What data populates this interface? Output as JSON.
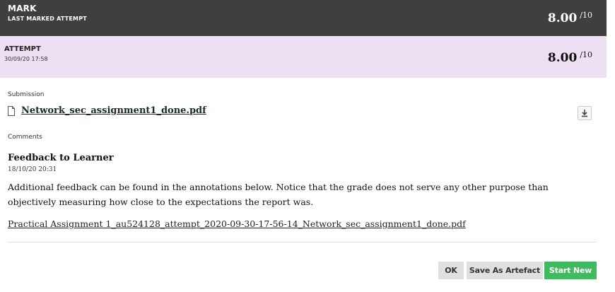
{
  "mark": {
    "title": "MARK",
    "subtitle": "LAST MARKED ATTEMPT",
    "score": "8.00",
    "max": "/10"
  },
  "attempt": {
    "title": "ATTEMPT",
    "date": "30/09/20 17:58",
    "score": "8.00",
    "max": "/10"
  },
  "submission": {
    "label": "Submission",
    "file_name": "Network_sec_assignment1_done.pdf",
    "file_icon": "document-icon",
    "download_icon": "download-icon"
  },
  "comments": {
    "label": "Comments",
    "feedback_title": "Feedback to Learner",
    "feedback_date": "18/10/20 20:31",
    "feedback_text": "Additional feedback can be found in the annotations below. Notice that the grade does not serve any other purpose than objectively measuring how close to the expectations the report was.",
    "attachment": "Practical Assignment 1_au524128_attempt_2020-09-30-17-56-14_Network_sec_assignment1_done.pdf"
  },
  "actions": {
    "ok_label": "OK",
    "save_label": "Save As Artefact",
    "start_label": "Start New"
  },
  "colors": {
    "mark_bar": "#3f3f3f",
    "attempt_bar": "#ede0f2",
    "start_button": "#3fba5f",
    "secondary_button": "#e0e0e0"
  }
}
